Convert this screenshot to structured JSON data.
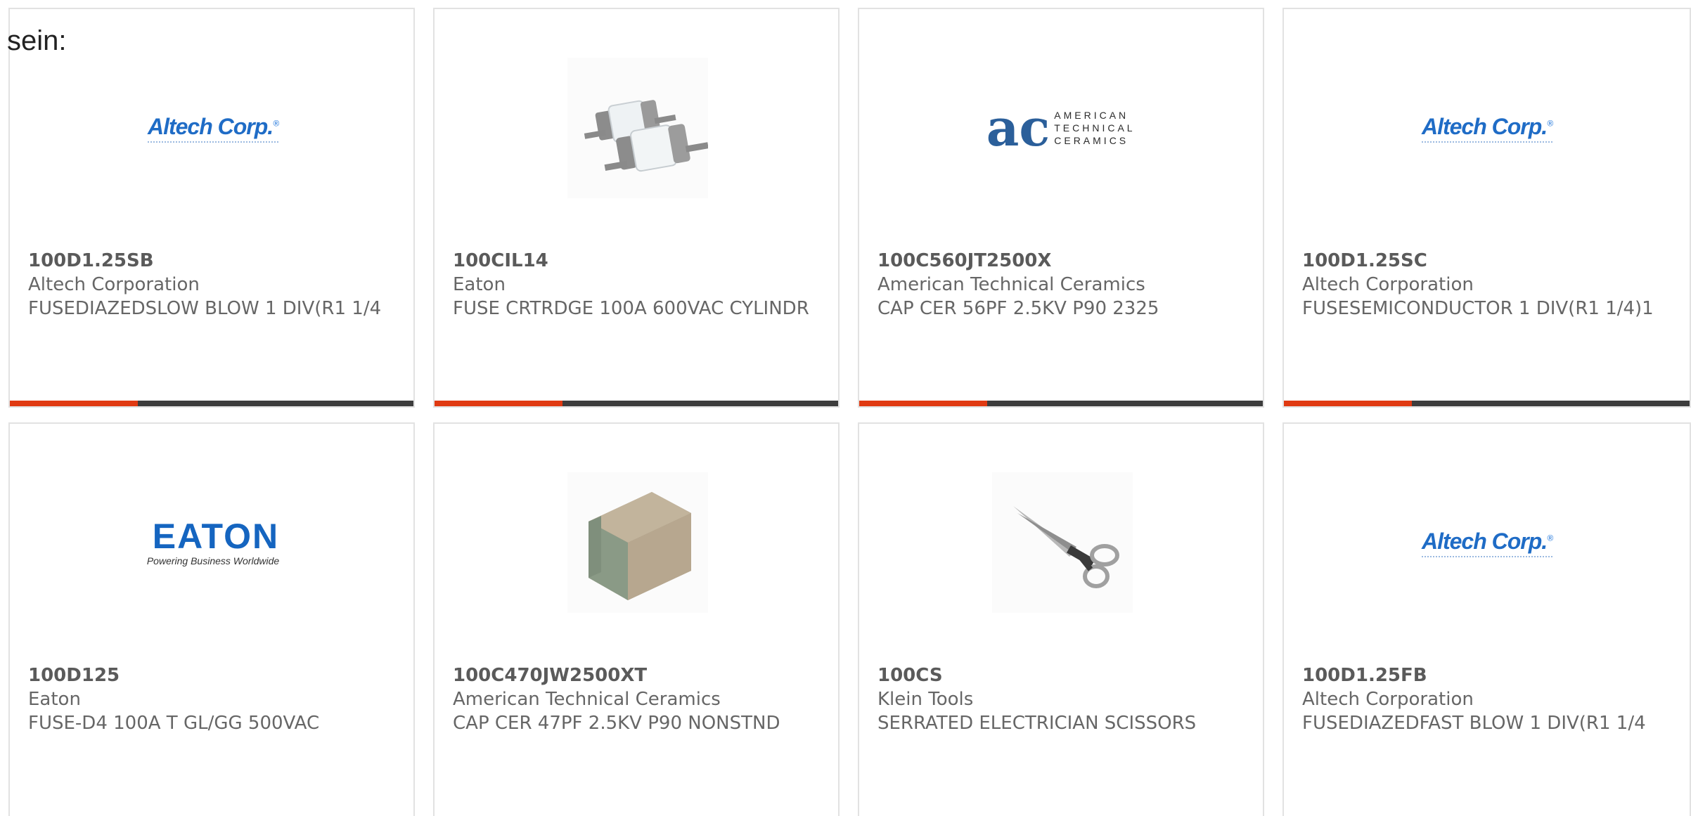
{
  "prefix_text": "sein:",
  "colors": {
    "accent": "#e03a12",
    "bar": "#3d3d3d",
    "border": "#e2e2e2"
  },
  "cards": [
    {
      "part": "100D1.25SB",
      "manufacturer": "Altech Corporation",
      "description": "FUSEDIAZEDSLOW BLOW 1 DIV(R1 1/4",
      "image": "altech-logo",
      "logo_text": "Altech Corp."
    },
    {
      "part": "100CIL14",
      "manufacturer": "Eaton",
      "description": "FUSE CRTRDGE 100A 600VAC CYLINDR",
      "image": "cartridge-fuse-photo"
    },
    {
      "part": "100C560JT2500X",
      "manufacturer": "American Technical Ceramics",
      "description": "CAP CER 56PF 2.5KV P90 2325",
      "image": "atc-logo",
      "logo_text": "AMERICAN TECHNICAL CERAMICS"
    },
    {
      "part": "100D1.25SC",
      "manufacturer": "Altech Corporation",
      "description": "FUSESEMICONDUCTOR 1 DIV(R1 1/4)1",
      "image": "altech-logo",
      "logo_text": "Altech Corp."
    },
    {
      "part": "100D125",
      "manufacturer": "Eaton",
      "description": "FUSE-D4 100A T GL/GG 500VAC",
      "image": "eaton-logo",
      "logo_text": "EATON",
      "logo_tagline": "Powering Business Worldwide"
    },
    {
      "part": "100C470JW2500XT",
      "manufacturer": "American Technical Ceramics",
      "description": "CAP CER 47PF 2.5KV P90 NONSTND",
      "image": "ceramic-capacitor-photo"
    },
    {
      "part": "100CS",
      "manufacturer": "Klein Tools",
      "description": "SERRATED ELECTRICIAN SCISSORS",
      "image": "scissors-photo"
    },
    {
      "part": "100D1.25FB",
      "manufacturer": "Altech Corporation",
      "description": "FUSEDIAZEDFAST BLOW 1 DIV(R1 1/4",
      "image": "altech-logo",
      "logo_text": "Altech Corp."
    }
  ]
}
